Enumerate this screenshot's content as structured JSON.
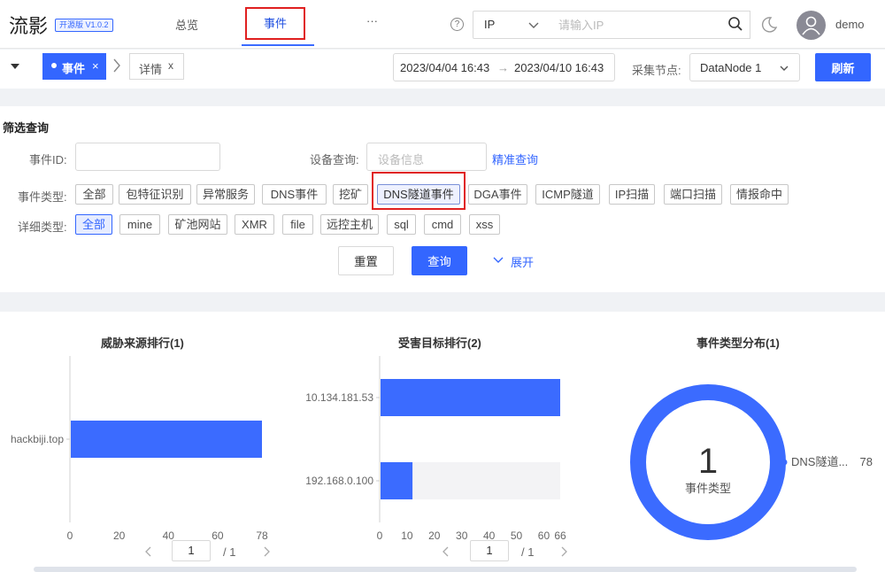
{
  "app": {
    "logo": "流影",
    "version": "开源版 V1.0.2",
    "user": "demo"
  },
  "nav": {
    "overview": "总览",
    "events": "事件",
    "more": "···",
    "help": "?"
  },
  "ip_search": {
    "type": "IP",
    "placeholder": "请输入IP"
  },
  "tabs": [
    {
      "label": "事件",
      "close": "×"
    },
    {
      "label": "详情",
      "close": "x"
    }
  ],
  "date": {
    "start": "2023/04/04 16:43",
    "sep": "→",
    "end": "2023/04/10 16:43"
  },
  "node": {
    "label": "采集节点:",
    "value": "DataNode 1"
  },
  "refresh": "刷新",
  "filter": {
    "title": "筛选查询",
    "event_id_label": "事件ID:",
    "device_label": "设备查询:",
    "device_placeholder": "设备信息",
    "precise": "精准查询",
    "event_type_label": "事件类型:",
    "event_types": [
      "全部",
      "包特征识别",
      "异常服务",
      "DNS事件",
      "挖矿",
      "DNS隧道事件",
      "DGA事件",
      "ICMP隧道",
      "IP扫描",
      "端口扫描",
      "情报命中"
    ],
    "detail_type_label": "详细类型:",
    "detail_types": [
      "全部",
      "mine",
      "矿池网站",
      "XMR",
      "file",
      "远控主机",
      "sql",
      "cmd",
      "xss"
    ],
    "reset": "重置",
    "query": "查询",
    "expand": "展开"
  },
  "chart_data": [
    {
      "type": "bar",
      "title": "威胁来源排行(1)",
      "categories": [
        "hackbiji.top"
      ],
      "values": [
        78
      ],
      "xlim": [
        0,
        78
      ],
      "xticks": [
        "0",
        "20",
        "40",
        "60",
        "78"
      ],
      "color": "#3b6bff",
      "pager": {
        "page": "1",
        "total": "/ 1"
      }
    },
    {
      "type": "bar",
      "title": "受害目标排行(2)",
      "categories": [
        "10.134.181.53",
        "192.168.0.100"
      ],
      "values": [
        66,
        12
      ],
      "xlim": [
        0,
        66
      ],
      "xticks": [
        "0",
        "10",
        "20",
        "30",
        "40",
        "50",
        "60",
        "66"
      ],
      "color": "#3b6bff",
      "pager": {
        "page": "1",
        "total": "/ 1"
      }
    },
    {
      "type": "pie",
      "title": "事件类型分布(1)",
      "center_value": "1",
      "center_label": "事件类型",
      "slices": [
        {
          "label": "DNS隧道...",
          "value": 78
        }
      ],
      "color": "#3b6bff"
    }
  ]
}
